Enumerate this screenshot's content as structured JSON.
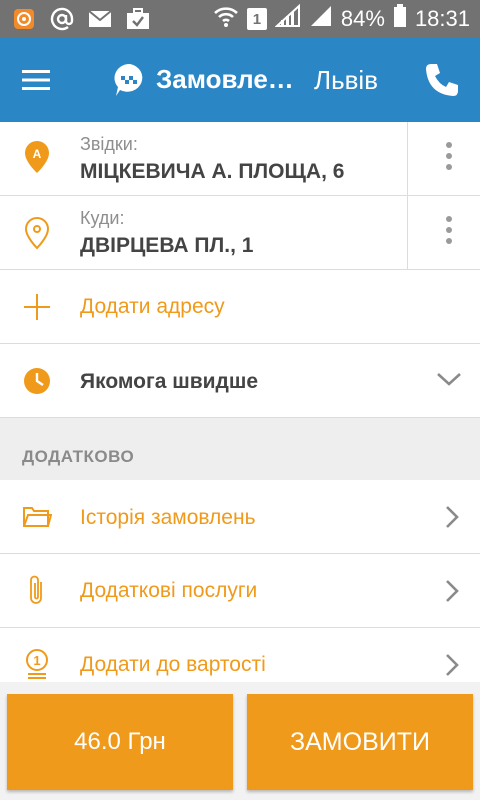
{
  "status_bar": {
    "battery": "84%",
    "time": "18:31",
    "sim": "1"
  },
  "app_bar": {
    "title": "Замовле…",
    "city": "Львів"
  },
  "from": {
    "label": "Звідки:",
    "value": "МІЦКЕВИЧА А. ПЛОЩА, 6",
    "pin_letter": "A"
  },
  "to": {
    "label": "Куди:",
    "value": "ДВІРЦЕВА ПЛ., 1"
  },
  "add_address": "Додати адресу",
  "time_option": "Якомога швидше",
  "section_title": "ДОДАТКОВО",
  "menu": [
    {
      "label": "Історія замовлень"
    },
    {
      "label": "Додаткові послуги"
    },
    {
      "label": "Додати до вартості",
      "coin": "1"
    }
  ],
  "bottom": {
    "price": "46.0 Грн",
    "order": "ЗАМОВИТИ"
  },
  "colors": {
    "app_bar": "#2b86c6",
    "accent": "#f09a1b",
    "status_bar": "#727272"
  }
}
